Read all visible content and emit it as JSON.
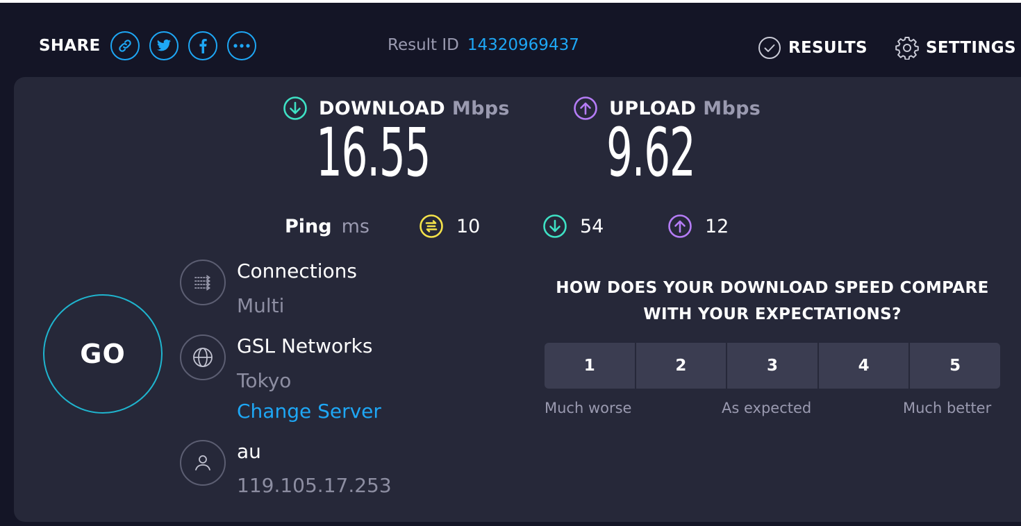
{
  "header": {
    "share_label": "SHARE",
    "share_buttons": [
      "link-icon",
      "twitter-icon",
      "facebook-icon",
      "more-icon"
    ],
    "result_id_label": "Result ID",
    "result_id_value": "14320969437",
    "results_label": "RESULTS",
    "settings_label": "SETTINGS"
  },
  "download": {
    "label": "DOWNLOAD",
    "unit": "Mbps",
    "value": "16.55",
    "color": "#3ee1c4"
  },
  "upload": {
    "label": "UPLOAD",
    "unit": "Mbps",
    "value": "9.62",
    "color": "#b57cf6"
  },
  "ping": {
    "label": "Ping",
    "unit": "ms",
    "jitter": "10",
    "download": "54",
    "upload": "12",
    "jitter_color": "#f4e24a"
  },
  "go_label": "GO",
  "connections": {
    "title": "Connections",
    "value": "Multi"
  },
  "server": {
    "name": "GSL Networks",
    "location": "Tokyo",
    "change_label": "Change Server"
  },
  "provider": {
    "name": "au",
    "ip": "119.105.17.253"
  },
  "compare": {
    "question_line1": "HOW DOES YOUR DOWNLOAD SPEED COMPARE",
    "question_line2": "WITH YOUR EXPECTATIONS?",
    "options": [
      "1",
      "2",
      "3",
      "4",
      "5"
    ],
    "low_label": "Much worse",
    "mid_label": "As expected",
    "high_label": "Much better"
  },
  "colors": {
    "accent": "#1ea7f5",
    "go_ring": "#1fb5cf",
    "panel": "#262839",
    "background": "#141526"
  }
}
